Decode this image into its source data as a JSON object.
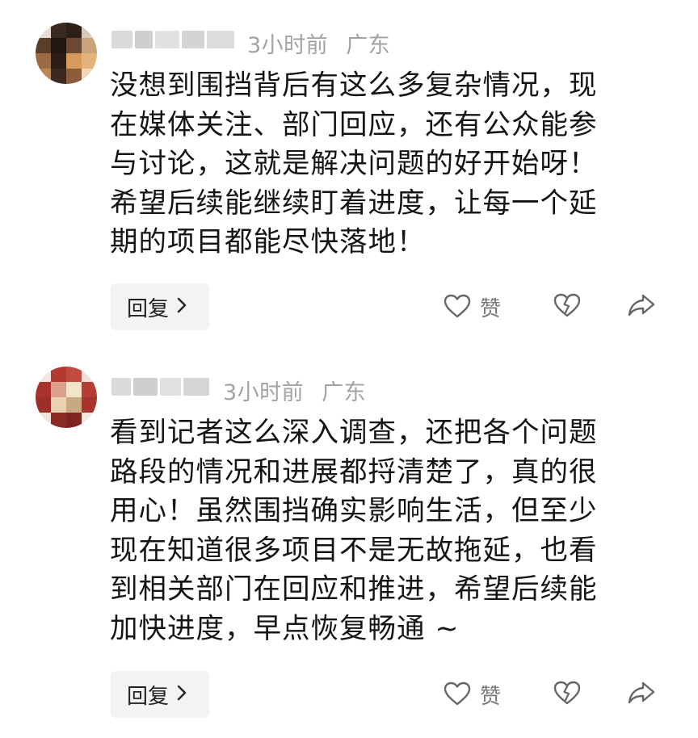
{
  "comments": [
    {
      "time": "3小时前",
      "location": "广东",
      "lines": [
        "没想到围挡背后有这么多复杂情况，现",
        "在媒体关注、部门回应，还有公众能参",
        "与讨论，这就是解决问题的好开始呀！",
        "希望后续能继续盯着进度，让每一个延",
        "期的项目都能尽快落地！"
      ],
      "reply_label": "回复",
      "like_label": "赞"
    },
    {
      "time": "3小时前",
      "location": "广东",
      "lines": [
        "看到记者这么深入调查，还把各个问题",
        "路段的情况和进展都捋清楚了，真的很",
        "用心！虽然围挡确实影响生活，但至少",
        "现在知道很多项目不是无故拖延，也看",
        "到相关部门在回应和推进，希望后续能",
        "加快进度，早点恢复畅通 ~"
      ],
      "reply_label": "回复",
      "like_label": "赞"
    }
  ],
  "icons": {
    "like": "heart-outline-icon",
    "dislike": "broken-heart-icon",
    "share": "share-arrow-icon",
    "chevron": "chevron-right-icon"
  }
}
